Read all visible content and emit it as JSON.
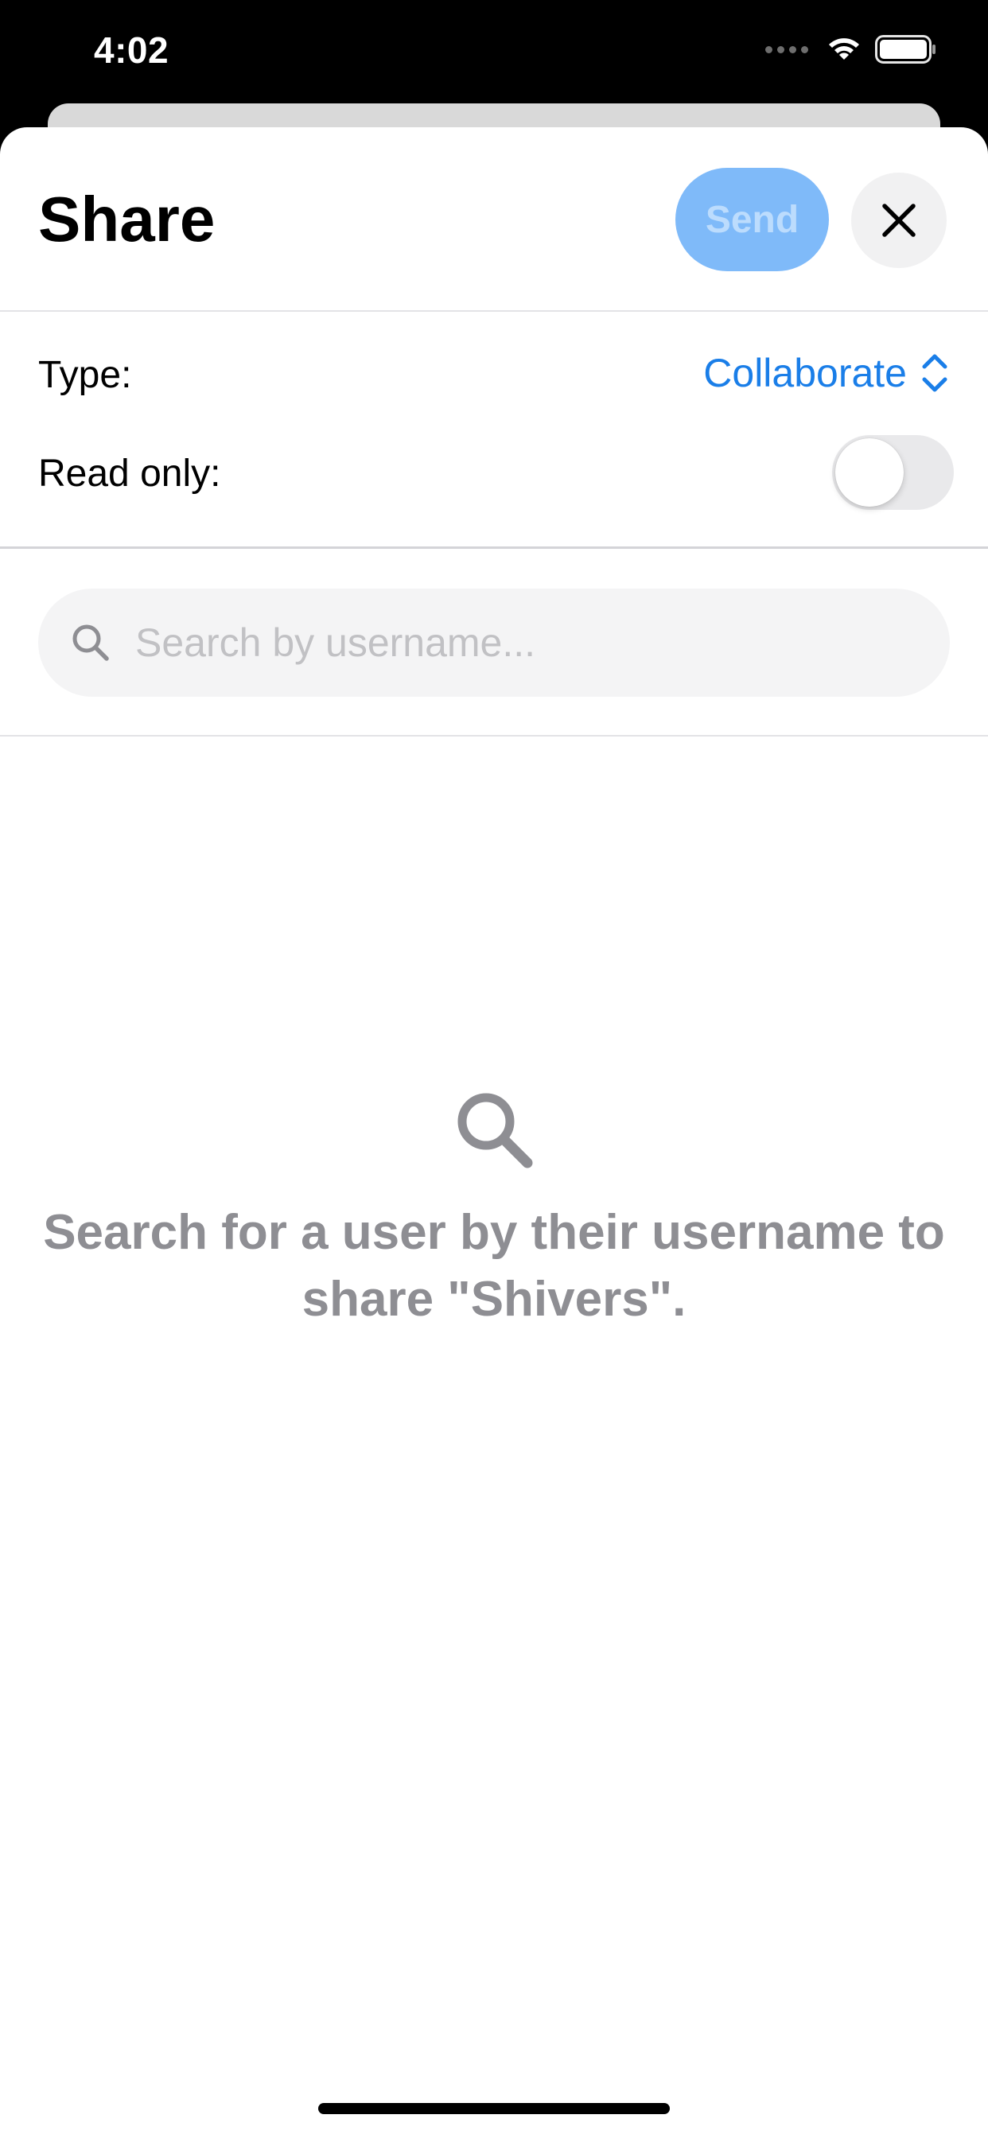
{
  "status_bar": {
    "time": "4:02"
  },
  "sheet": {
    "title": "Share",
    "send_label": "Send",
    "colors": {
      "accent": "#1a7ee8",
      "send_disabled_bg": "#7fbaf9"
    }
  },
  "options": {
    "type_label": "Type:",
    "type_value": "Collaborate",
    "read_only_label": "Read only:",
    "read_only_on": false
  },
  "search": {
    "placeholder": "Search by username..."
  },
  "empty_state": {
    "message": "Search for a user by their username to share \"Shivers\"."
  },
  "icons": {
    "close": "close-icon",
    "search": "search-icon",
    "chevron": "chevron-up-down-icon"
  }
}
